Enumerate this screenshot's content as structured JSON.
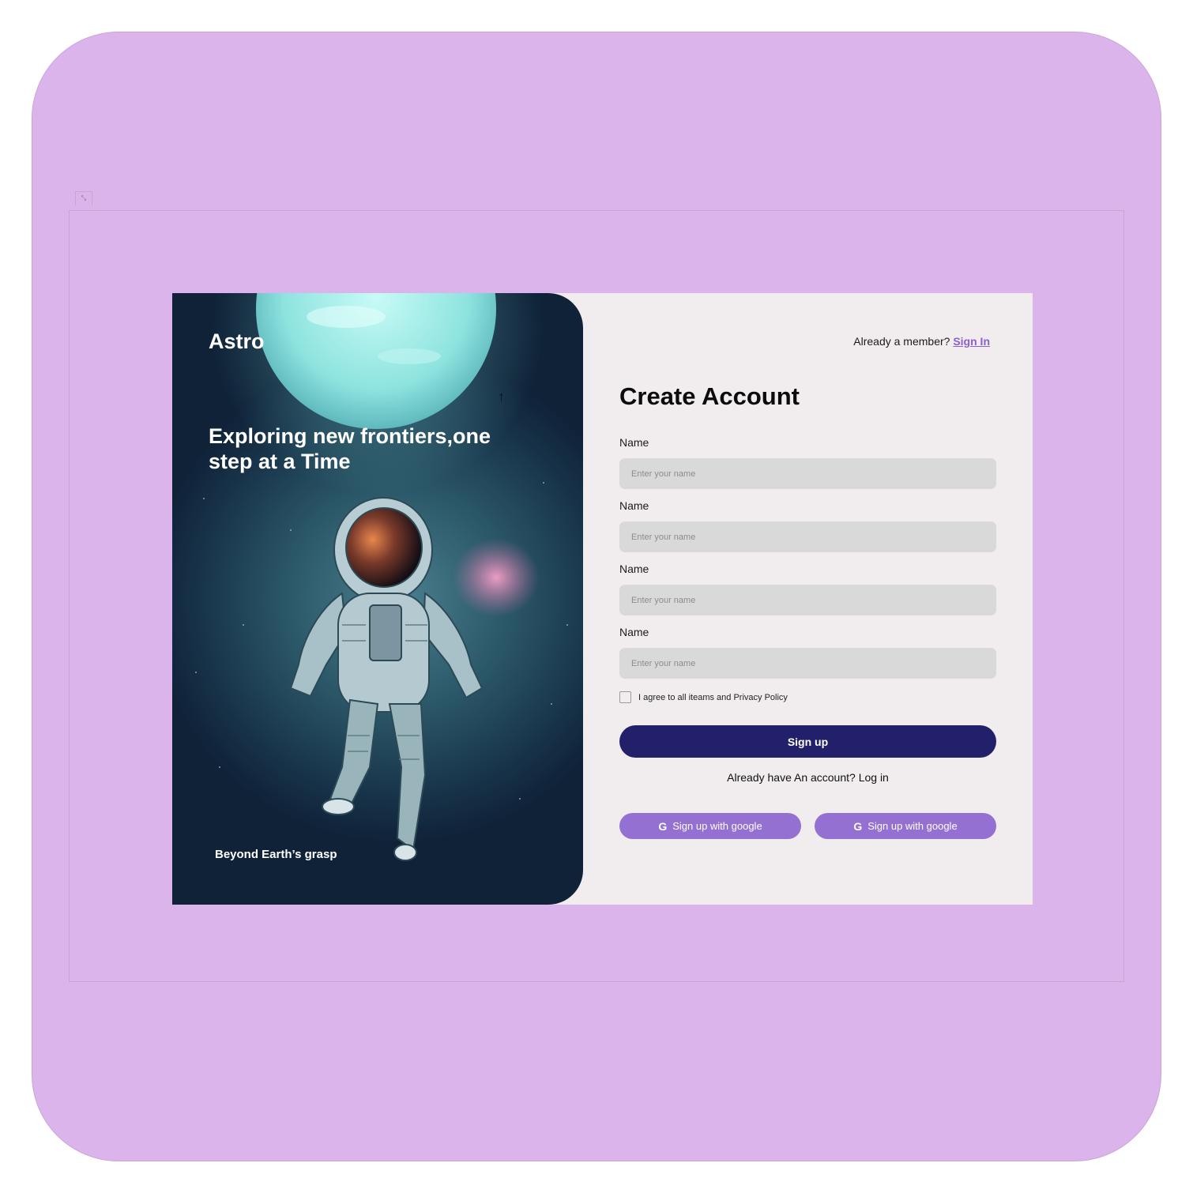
{
  "hero": {
    "brand": "Astro",
    "tagline": "Exploring new frontiers,one step at a Time",
    "caption": "Beyond Earth’s grasp"
  },
  "header": {
    "member_text": "Already a member?",
    "signin_label": "Sign In"
  },
  "form": {
    "title": "Create Account",
    "fields": [
      {
        "label": "Name",
        "placeholder": "Enter your name"
      },
      {
        "label": "Name",
        "placeholder": "Enter your name"
      },
      {
        "label": "Name",
        "placeholder": "Enter your name"
      },
      {
        "label": "Name",
        "placeholder": "Enter your name"
      }
    ],
    "agree_text": "I agree to all iteams and Privacy Policy",
    "signup_label": "Sign up",
    "login_text": "Already have An account? Log in",
    "google_buttons": [
      {
        "icon": "G",
        "label": "Sign up with google"
      },
      {
        "icon": "G",
        "label": "Sign up with google"
      }
    ]
  },
  "colors": {
    "frame": "#dab4ea",
    "card": "#f1eced",
    "primary_button": "#22206a",
    "google_button": "#9470d2",
    "link": "#8a5fd0"
  }
}
